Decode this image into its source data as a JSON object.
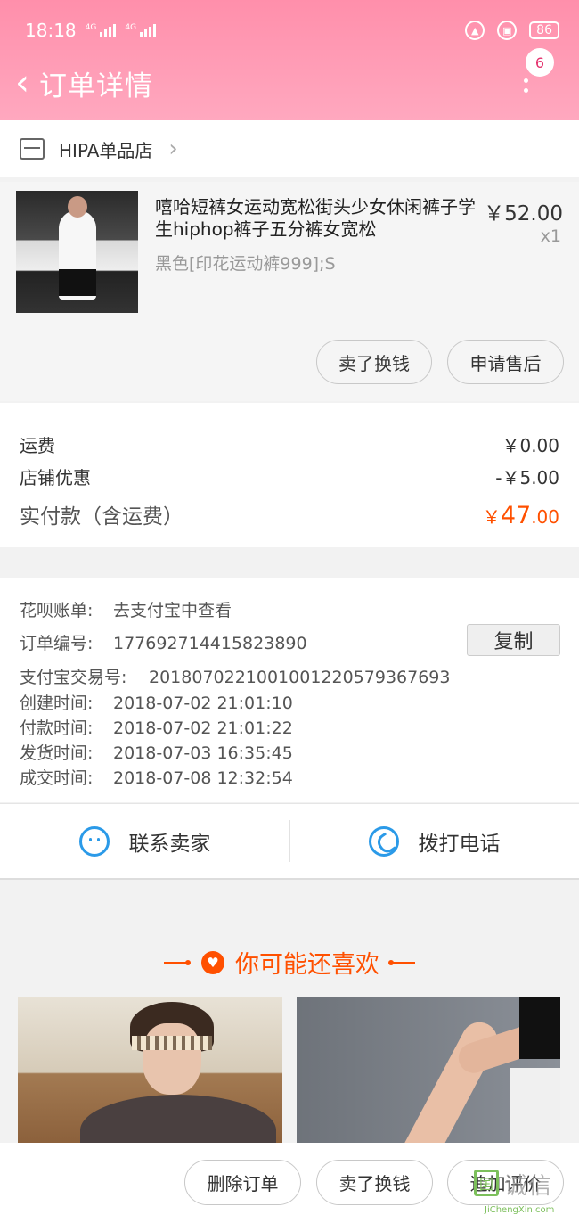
{
  "status_bar": {
    "time": "18:18",
    "network": [
      "4G",
      "4G"
    ],
    "battery": "86"
  },
  "header": {
    "title": "订单详情",
    "badge_count": "6"
  },
  "shop": {
    "name": "HIPA单品店"
  },
  "product": {
    "title": "嘻哈短裤女运动宽松街头少女休闲裤子学生hiphop裤子五分裤女宽松",
    "price": "￥52.00",
    "quantity": "x1",
    "spec": "黑色[印花运动裤999];S",
    "buttons": {
      "sell": "卖了换钱",
      "after_sale": "申请售后"
    }
  },
  "fees": {
    "shipping_label": "运费",
    "shipping_value": "￥0.00",
    "discount_label": "店铺优惠",
    "discount_value": "-￥5.00",
    "paid_label": "实付款（含运费）",
    "paid_currency": "￥",
    "paid_int": "47",
    "paid_dec": ".00"
  },
  "order_info": {
    "huabei_label": "花呗账单:",
    "huabei_value": "去支付宝中查看",
    "order_no_label": "订单编号:",
    "order_no_value": "177692714415823890",
    "copy_label": "复制",
    "alipay_label": "支付宝交易号:",
    "alipay_value": "2018070221001001220579367693",
    "created_label": "创建时间:",
    "created_value": "2018-07-02 21:01:10",
    "paid_time_label": "付款时间:",
    "paid_time_value": "2018-07-02 21:01:22",
    "shipped_label": "发货时间:",
    "shipped_value": "2018-07-03 16:35:45",
    "closed_label": "成交时间:",
    "closed_value": "2018-07-08 12:32:54"
  },
  "contact": {
    "seller": "联系卖家",
    "phone": "拨打电话"
  },
  "recommend": {
    "title": "你可能还喜欢"
  },
  "bottom_bar": {
    "delete": "删除订单",
    "sell": "卖了换钱",
    "review": "追加评价"
  },
  "watermark": {
    "text": "诚信",
    "url": "JiChengXin.com"
  },
  "colors": {
    "header": "#ff8fab",
    "accent": "#ff5000",
    "contact_icon": "#2b9ae8"
  }
}
